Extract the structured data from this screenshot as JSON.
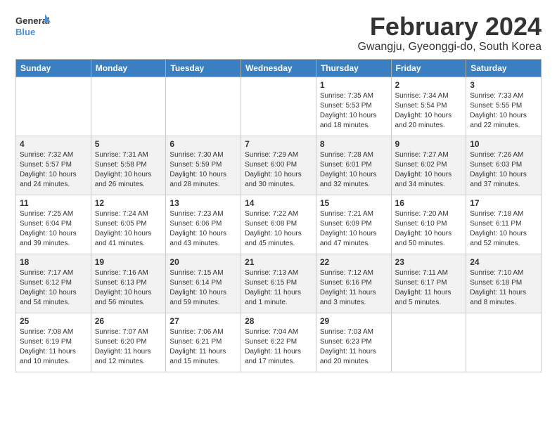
{
  "logo": {
    "line1": "General",
    "line2": "Blue"
  },
  "title": "February 2024",
  "subtitle": "Gwangju, Gyeonggi-do, South Korea",
  "weekdays": [
    "Sunday",
    "Monday",
    "Tuesday",
    "Wednesday",
    "Thursday",
    "Friday",
    "Saturday"
  ],
  "weeks": [
    [
      {
        "day": "",
        "info": ""
      },
      {
        "day": "",
        "info": ""
      },
      {
        "day": "",
        "info": ""
      },
      {
        "day": "",
        "info": ""
      },
      {
        "day": "1",
        "info": "Sunrise: 7:35 AM\nSunset: 5:53 PM\nDaylight: 10 hours\nand 18 minutes."
      },
      {
        "day": "2",
        "info": "Sunrise: 7:34 AM\nSunset: 5:54 PM\nDaylight: 10 hours\nand 20 minutes."
      },
      {
        "day": "3",
        "info": "Sunrise: 7:33 AM\nSunset: 5:55 PM\nDaylight: 10 hours\nand 22 minutes."
      }
    ],
    [
      {
        "day": "4",
        "info": "Sunrise: 7:32 AM\nSunset: 5:57 PM\nDaylight: 10 hours\nand 24 minutes."
      },
      {
        "day": "5",
        "info": "Sunrise: 7:31 AM\nSunset: 5:58 PM\nDaylight: 10 hours\nand 26 minutes."
      },
      {
        "day": "6",
        "info": "Sunrise: 7:30 AM\nSunset: 5:59 PM\nDaylight: 10 hours\nand 28 minutes."
      },
      {
        "day": "7",
        "info": "Sunrise: 7:29 AM\nSunset: 6:00 PM\nDaylight: 10 hours\nand 30 minutes."
      },
      {
        "day": "8",
        "info": "Sunrise: 7:28 AM\nSunset: 6:01 PM\nDaylight: 10 hours\nand 32 minutes."
      },
      {
        "day": "9",
        "info": "Sunrise: 7:27 AM\nSunset: 6:02 PM\nDaylight: 10 hours\nand 34 minutes."
      },
      {
        "day": "10",
        "info": "Sunrise: 7:26 AM\nSunset: 6:03 PM\nDaylight: 10 hours\nand 37 minutes."
      }
    ],
    [
      {
        "day": "11",
        "info": "Sunrise: 7:25 AM\nSunset: 6:04 PM\nDaylight: 10 hours\nand 39 minutes."
      },
      {
        "day": "12",
        "info": "Sunrise: 7:24 AM\nSunset: 6:05 PM\nDaylight: 10 hours\nand 41 minutes."
      },
      {
        "day": "13",
        "info": "Sunrise: 7:23 AM\nSunset: 6:06 PM\nDaylight: 10 hours\nand 43 minutes."
      },
      {
        "day": "14",
        "info": "Sunrise: 7:22 AM\nSunset: 6:08 PM\nDaylight: 10 hours\nand 45 minutes."
      },
      {
        "day": "15",
        "info": "Sunrise: 7:21 AM\nSunset: 6:09 PM\nDaylight: 10 hours\nand 47 minutes."
      },
      {
        "day": "16",
        "info": "Sunrise: 7:20 AM\nSunset: 6:10 PM\nDaylight: 10 hours\nand 50 minutes."
      },
      {
        "day": "17",
        "info": "Sunrise: 7:18 AM\nSunset: 6:11 PM\nDaylight: 10 hours\nand 52 minutes."
      }
    ],
    [
      {
        "day": "18",
        "info": "Sunrise: 7:17 AM\nSunset: 6:12 PM\nDaylight: 10 hours\nand 54 minutes."
      },
      {
        "day": "19",
        "info": "Sunrise: 7:16 AM\nSunset: 6:13 PM\nDaylight: 10 hours\nand 56 minutes."
      },
      {
        "day": "20",
        "info": "Sunrise: 7:15 AM\nSunset: 6:14 PM\nDaylight: 10 hours\nand 59 minutes."
      },
      {
        "day": "21",
        "info": "Sunrise: 7:13 AM\nSunset: 6:15 PM\nDaylight: 11 hours\nand 1 minute."
      },
      {
        "day": "22",
        "info": "Sunrise: 7:12 AM\nSunset: 6:16 PM\nDaylight: 11 hours\nand 3 minutes."
      },
      {
        "day": "23",
        "info": "Sunrise: 7:11 AM\nSunset: 6:17 PM\nDaylight: 11 hours\nand 5 minutes."
      },
      {
        "day": "24",
        "info": "Sunrise: 7:10 AM\nSunset: 6:18 PM\nDaylight: 11 hours\nand 8 minutes."
      }
    ],
    [
      {
        "day": "25",
        "info": "Sunrise: 7:08 AM\nSunset: 6:19 PM\nDaylight: 11 hours\nand 10 minutes."
      },
      {
        "day": "26",
        "info": "Sunrise: 7:07 AM\nSunset: 6:20 PM\nDaylight: 11 hours\nand 12 minutes."
      },
      {
        "day": "27",
        "info": "Sunrise: 7:06 AM\nSunset: 6:21 PM\nDaylight: 11 hours\nand 15 minutes."
      },
      {
        "day": "28",
        "info": "Sunrise: 7:04 AM\nSunset: 6:22 PM\nDaylight: 11 hours\nand 17 minutes."
      },
      {
        "day": "29",
        "info": "Sunrise: 7:03 AM\nSunset: 6:23 PM\nDaylight: 11 hours\nand 20 minutes."
      },
      {
        "day": "",
        "info": ""
      },
      {
        "day": "",
        "info": ""
      }
    ]
  ]
}
